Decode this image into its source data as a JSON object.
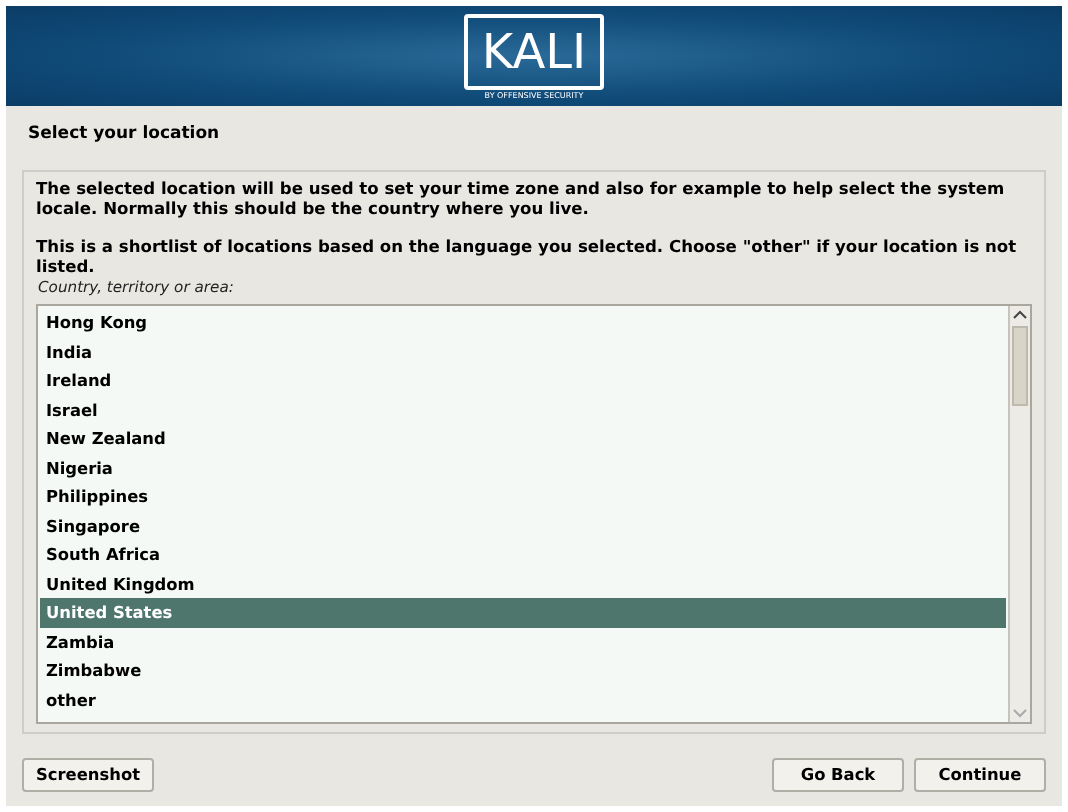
{
  "banner": {
    "logo": "KALI",
    "tagline": "BY OFFENSIVE SECURITY"
  },
  "title": "Select your location",
  "paragraphs": [
    "The selected location will be used to set your time zone and also for example to help select the system locale. Normally this should be the country where you live.",
    "This is a shortlist of locations based on the language you selected. Choose \"other\" if your location is not listed."
  ],
  "list_label": "Country, territory or area:",
  "locations": [
    {
      "label": "Hong Kong",
      "selected": false
    },
    {
      "label": "India",
      "selected": false
    },
    {
      "label": "Ireland",
      "selected": false
    },
    {
      "label": "Israel",
      "selected": false
    },
    {
      "label": "New Zealand",
      "selected": false
    },
    {
      "label": "Nigeria",
      "selected": false
    },
    {
      "label": "Philippines",
      "selected": false
    },
    {
      "label": "Singapore",
      "selected": false
    },
    {
      "label": "South Africa",
      "selected": false
    },
    {
      "label": "United Kingdom",
      "selected": false
    },
    {
      "label": "United States",
      "selected": true
    },
    {
      "label": "Zambia",
      "selected": false
    },
    {
      "label": "Zimbabwe",
      "selected": false
    },
    {
      "label": "other",
      "selected": false
    }
  ],
  "buttons": {
    "left": [
      "Screenshot"
    ],
    "right": [
      "Go Back",
      "Continue"
    ]
  }
}
